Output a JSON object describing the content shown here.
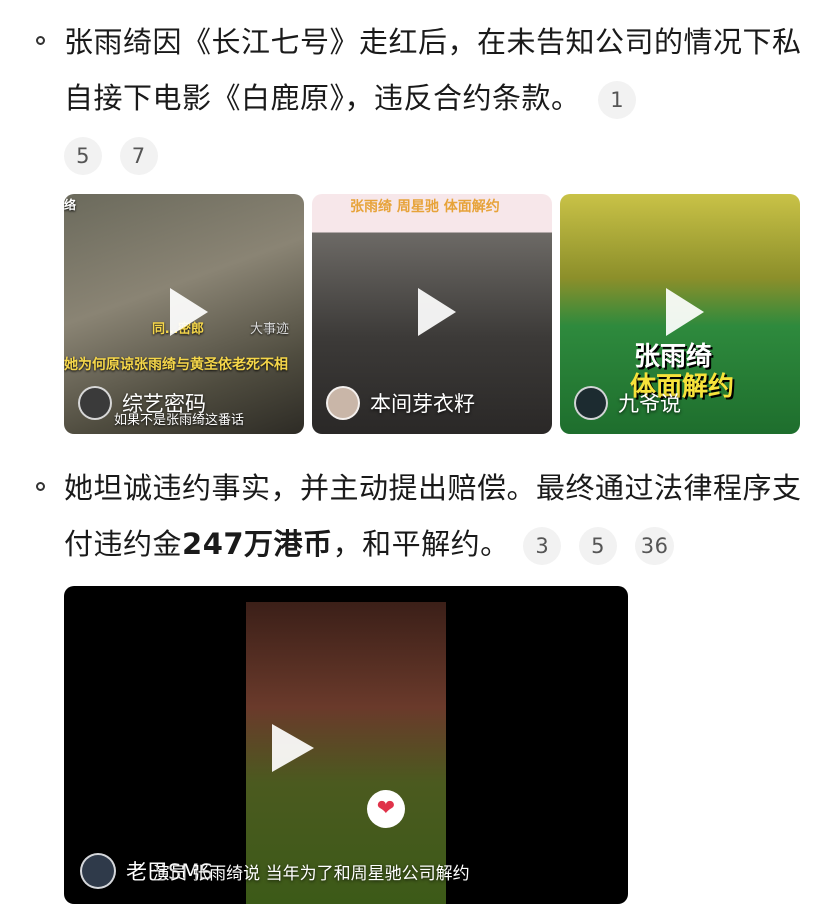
{
  "paragraphs": [
    {
      "text": "张雨绮因《长江七号》走红后，在未告知公司的情况下私自接下电影《白鹿原》，违反合约条款。",
      "refs": [
        "1",
        "5",
        "7"
      ]
    },
    {
      "text_before": "她坦诚违约事实，并主动提出赔偿。最终通过法律程序支付违约金",
      "text_bold": "247万港币",
      "text_after": "，和平解约。",
      "refs": [
        "3",
        "5",
        "36"
      ]
    }
  ],
  "videos": [
    {
      "author": "综艺密码",
      "overlay_top": "同…密郎",
      "overlay_corner": "大事迹",
      "overlay_banner": "她为何原谅张雨绮与黄圣依老死不相",
      "overlay_bottom": "如果不是张雨绮这番话",
      "overlay_topleft": "络"
    },
    {
      "author": "本间芽衣籽",
      "overlay_banner": "张雨绮 周星驰 体面解约"
    },
    {
      "author": "九爷说",
      "overlay_title1": "张雨绮",
      "overlay_title2": "体面解约"
    }
  ],
  "big_video": {
    "author": "老巴SMS",
    "caption": "演员 张雨绮说 当年为了和周星驰公司解约"
  },
  "colors": {
    "ref_bg": "#f2f2f2",
    "heart": "#e0334a"
  }
}
